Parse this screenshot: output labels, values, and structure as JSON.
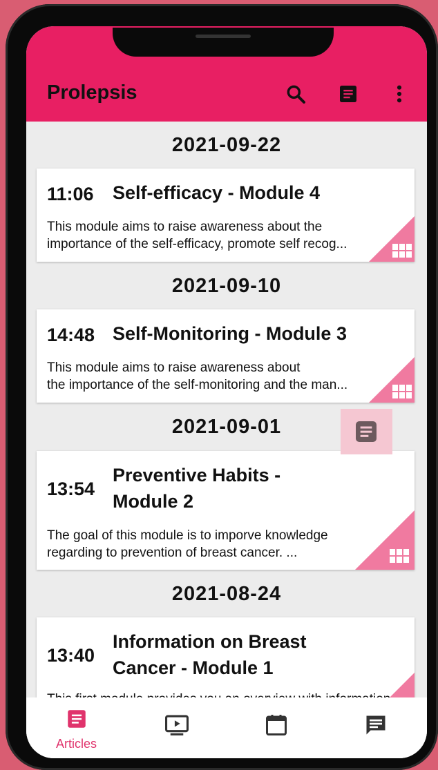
{
  "app": {
    "title": "Prolepsis"
  },
  "toolbar": {
    "icons": [
      "search-icon",
      "article-icon",
      "more-vert-icon"
    ]
  },
  "colors": {
    "primary": "#e81f63",
    "accent_soft": "#f07aa0",
    "background": "#ececec"
  },
  "articles": [
    {
      "date": "2021-09-22",
      "time": "11:06",
      "title": "Self-efficacy - Module 4",
      "description": "This module aims to raise awareness about the\nimportance of the self-efficacy, promote self recog..."
    },
    {
      "date": "2021-09-10",
      "time": "14:48",
      "title": "Self-Monitoring - Module 3",
      "description": "This module aims to raise awareness about\nthe importance of the self-monitoring and the man..."
    },
    {
      "date": "2021-09-01",
      "time": "13:54",
      "title": "Preventive Habits - Module 2",
      "description": "The goal of this module is to imporve knowledge\nregarding to prevention of breast cancer. ..."
    },
    {
      "date": "2021-08-24",
      "time": "13:40",
      "title": "Information on Breast Cancer - Module 1",
      "description": "This first module provides you an overview with information..."
    }
  ],
  "bottom_nav": [
    {
      "label": "Articles",
      "icon": "article-icon",
      "active": true
    },
    {
      "label": "",
      "icon": "video-icon",
      "active": false
    },
    {
      "label": "",
      "icon": "calendar-icon",
      "active": false
    },
    {
      "label": "",
      "icon": "chat-icon",
      "active": false
    }
  ]
}
